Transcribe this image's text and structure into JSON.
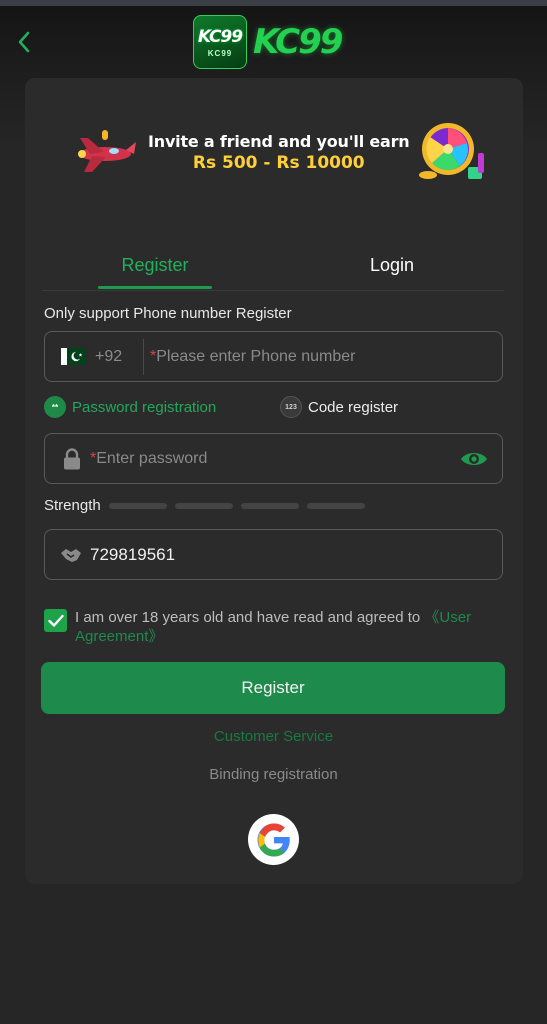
{
  "header": {
    "back_icon": "chevron-left-icon",
    "logo_badge_text": "KC99",
    "logo_badge_sub": "KC99",
    "logo_text": "KC99"
  },
  "banner": {
    "line1": "Invite a friend and you'll earn",
    "line2": "Rs 500 - Rs 10000"
  },
  "tabs": {
    "register": "Register",
    "login": "Login",
    "active": "register"
  },
  "form": {
    "note": "Only support Phone number Register",
    "country_code": "+92",
    "phone_required_mark": "*",
    "phone_placeholder": "Please enter Phone number",
    "option_password": "Password registration",
    "option_password_icon_text": "**",
    "option_code": "Code register",
    "option_code_icon_text": "123",
    "password_required_mark": "*",
    "password_placeholder": "Enter password",
    "strength_label": "Strength",
    "strength_level": 0,
    "strength_segments": 4,
    "code_value": "729819561",
    "agree_text": "I am over 18 years old and have read and agreed to ",
    "agree_link": "《User Agreement》",
    "agree_checked": true,
    "register_button": "Register",
    "customer_service": "Customer Service",
    "binding_registration": "Binding registration"
  },
  "colors": {
    "accent": "#1e8a4c",
    "accent_text": "#22b05a",
    "background": "#262626",
    "card": "#2b2b2b",
    "required": "#d64545"
  }
}
